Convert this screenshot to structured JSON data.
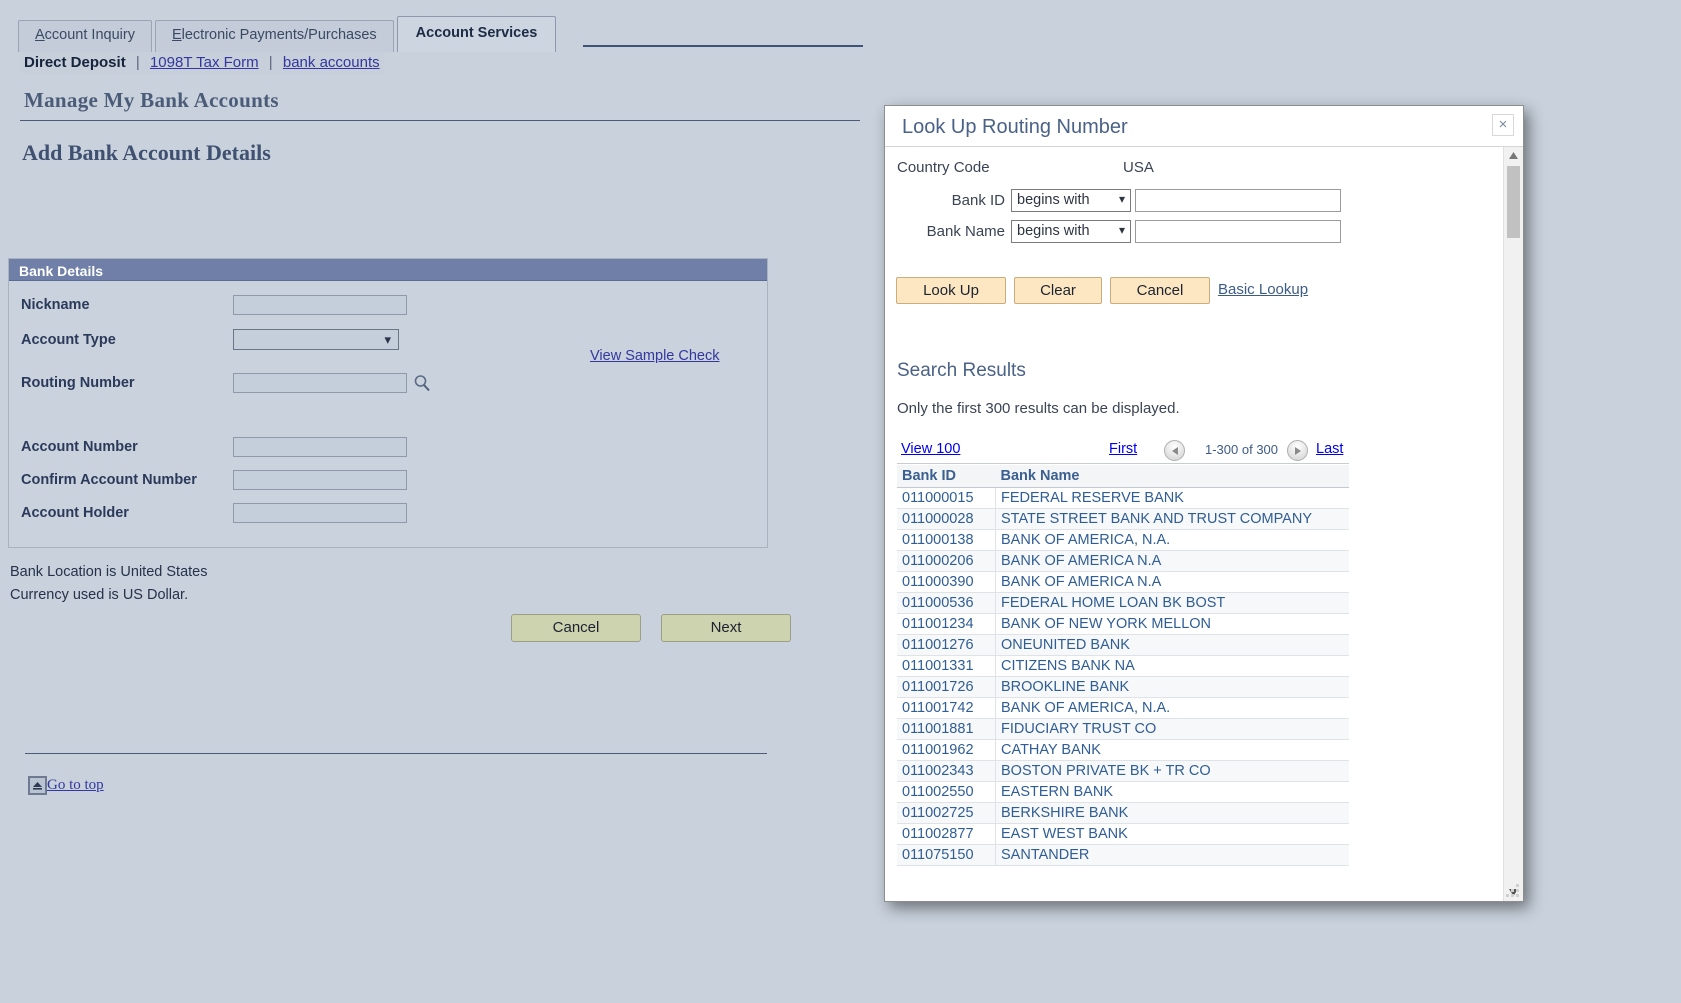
{
  "tabs": [
    {
      "label": "Account Inquiry",
      "accel": "A",
      "active": false
    },
    {
      "label": "Electronic Payments/Purchases",
      "accel": "E",
      "active": false
    },
    {
      "label": "Account Services",
      "accel": "",
      "active": true
    }
  ],
  "subnav": {
    "current": "Direct Deposit",
    "sep": "|",
    "links": [
      "1098T Tax Form",
      "bank accounts"
    ]
  },
  "page": {
    "title": "Manage My Bank Accounts",
    "section_title": "Add Bank Account Details"
  },
  "bank_details": {
    "group_label": "Bank Details",
    "fields": [
      {
        "label": "Nickname",
        "type": "text",
        "value": ""
      },
      {
        "label": "Account Type",
        "type": "select",
        "value": ""
      },
      {
        "label": "Routing Number",
        "type": "text-lookup",
        "value": ""
      },
      {
        "label": "Account Number",
        "type": "text",
        "value": ""
      },
      {
        "label": "Confirm Account Number",
        "type": "text",
        "value": ""
      },
      {
        "label": "Account Holder",
        "type": "text",
        "value": ""
      }
    ],
    "sample_check_link": "View Sample Check"
  },
  "notes": {
    "location": "Bank Location is United States",
    "currency": "Currency used is US Dollar."
  },
  "form_buttons": {
    "cancel": "Cancel",
    "next": "Next"
  },
  "footer": {
    "go_to_top": "Go to top"
  },
  "modal": {
    "title": "Look Up Routing Number",
    "close_label": "×",
    "country_code_label": "Country Code",
    "country_code_value": "USA",
    "search_fields": [
      {
        "label": "Bank ID",
        "operator": "begins with",
        "value": ""
      },
      {
        "label": "Bank Name",
        "operator": "begins with",
        "value": ""
      }
    ],
    "buttons": {
      "look_up": "Look Up",
      "clear": "Clear",
      "cancel": "Cancel",
      "basic_lookup": "Basic Lookup"
    },
    "results": {
      "heading": "Search Results",
      "limit_note": "Only the first 300 results can be displayed.",
      "pager": {
        "view": "View 100",
        "first": "First",
        "count": "1-300 of 300",
        "last": "Last"
      },
      "columns": [
        "Bank ID",
        "Bank Name"
      ],
      "rows": [
        [
          "011000015",
          "FEDERAL RESERVE BANK"
        ],
        [
          "011000028",
          "STATE STREET BANK AND TRUST COMPANY"
        ],
        [
          "011000138",
          "BANK OF AMERICA, N.A."
        ],
        [
          "011000206",
          "BANK OF AMERICA N.A"
        ],
        [
          "011000390",
          "BANK OF AMERICA N.A"
        ],
        [
          "011000536",
          "FEDERAL HOME LOAN BK BOST"
        ],
        [
          "011001234",
          "BANK OF NEW YORK MELLON"
        ],
        [
          "011001276",
          "ONEUNITED BANK"
        ],
        [
          "011001331",
          "CITIZENS BANK NA"
        ],
        [
          "011001726",
          "BROOKLINE BANK"
        ],
        [
          "011001742",
          "BANK OF AMERICA, N.A."
        ],
        [
          "011001881",
          "FIDUCIARY TRUST CO"
        ],
        [
          "011001962",
          "CATHAY BANK"
        ],
        [
          "011002343",
          "BOSTON PRIVATE BK + TR CO"
        ],
        [
          "011002550",
          "EASTERN BANK"
        ],
        [
          "011002725",
          "BERKSHIRE BANK"
        ],
        [
          "011002877",
          "EAST WEST BANK"
        ],
        [
          "011075150",
          "SANTANDER"
        ]
      ]
    }
  },
  "colors": {
    "page_bg": "#c8d1dc",
    "group_header": "#6f7fa8",
    "link": "#33379e",
    "heading": "#4b5c79",
    "button_green": "#ccd3ae",
    "button_tan": "#fce7c2",
    "results_text": "#2f5d95"
  }
}
